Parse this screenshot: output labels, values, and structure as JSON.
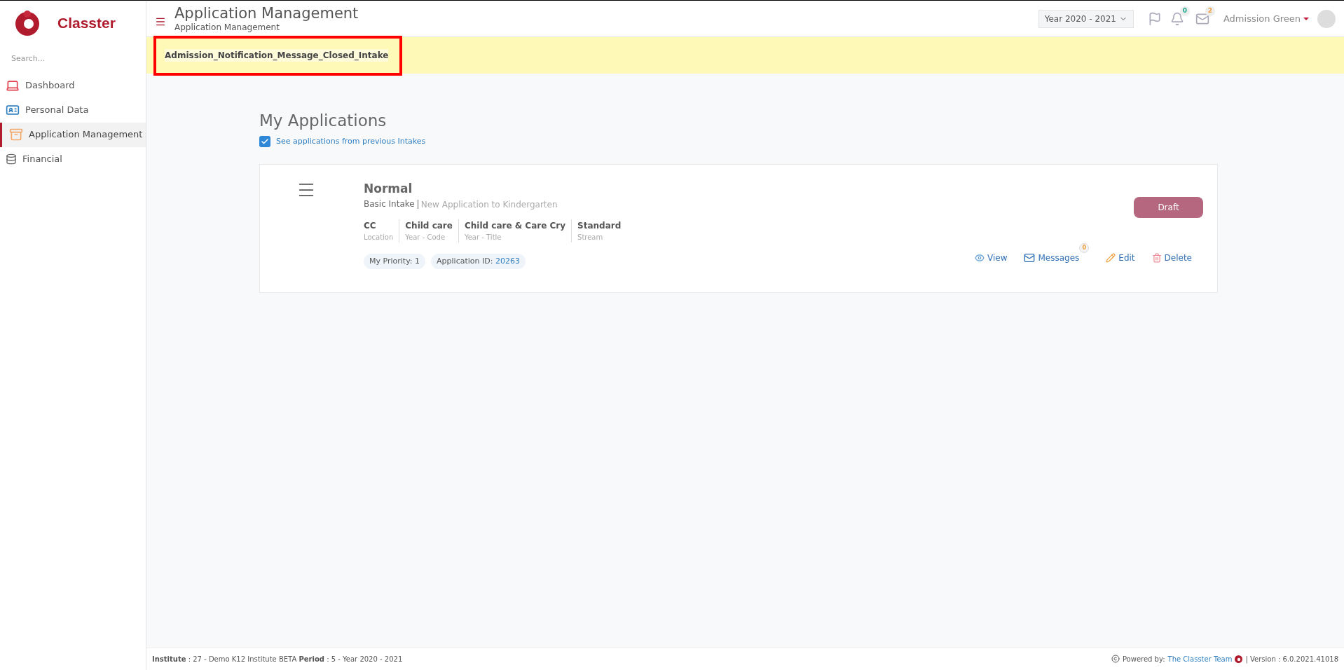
{
  "brand": {
    "name": "Classter"
  },
  "sidebar": {
    "search_placeholder": "Search...",
    "items": [
      {
        "label": "Dashboard",
        "kind": "laptop",
        "selected": false
      },
      {
        "label": "Personal Data",
        "kind": "card",
        "selected": false
      },
      {
        "label": "Application Management",
        "kind": "drawer",
        "selected": true
      },
      {
        "label": "Financial",
        "kind": "coins",
        "selected": false
      }
    ]
  },
  "header": {
    "title": "Application Management",
    "subtitle": "Application Management",
    "year": "Year 2020 - 2021",
    "notifications": "0",
    "messages": "2",
    "user": "Admission Green"
  },
  "notice": {
    "message": "Admission_Notification_Message_Closed_Intake"
  },
  "page": {
    "title": "My Applications",
    "show_previous": {
      "label": "See applications from previous Intakes",
      "checked": true
    }
  },
  "applications": [
    {
      "title": "Normal",
      "intake": "Basic Intake",
      "description": "New Application to Kindergarten",
      "fields": [
        {
          "value": "CC",
          "label": "Location"
        },
        {
          "value": "Child care",
          "label": "Year - Code"
        },
        {
          "value": "Child care & Care Cry",
          "label": "Year - Title"
        },
        {
          "value": "Standard",
          "label": "Stream"
        }
      ],
      "priority": "My Priority: 1",
      "id_label": "Application ID:",
      "id_value": "20263",
      "status": "Draft",
      "actions": [
        {
          "kind": "view",
          "label": "View"
        },
        {
          "kind": "messages",
          "label": "Messages",
          "badge": "0"
        },
        {
          "kind": "edit",
          "label": "Edit"
        },
        {
          "kind": "delete",
          "label": "Delete"
        }
      ]
    }
  ],
  "footer": {
    "info": "**Institute** : 27 - Demo K12 Institute BETA **Period** : 5 - Year 2020 - 2021",
    "powered_label": "Powered by:",
    "powered_link": "The Classter Team",
    "version": "| Version : 6.0.2021.41018"
  }
}
